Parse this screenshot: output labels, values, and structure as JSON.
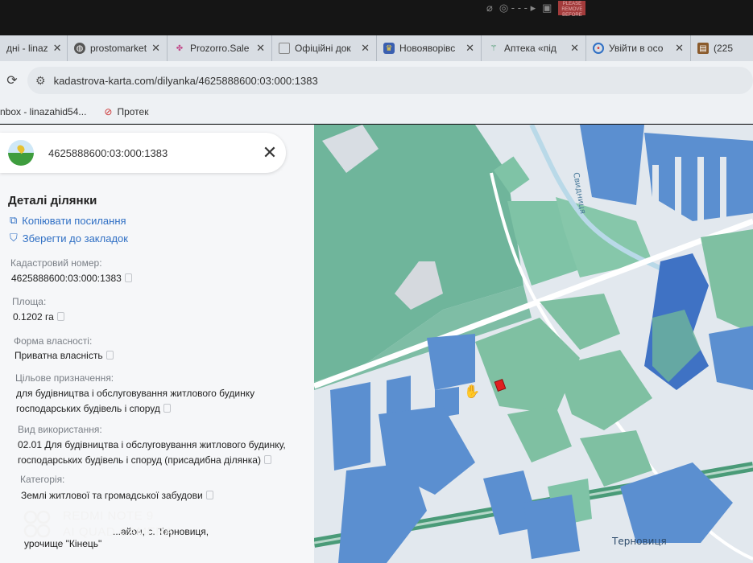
{
  "camera_bar": {
    "badge_text": "PLEASE REMOVE BEFORE"
  },
  "tabs": [
    {
      "label": "дні - linaz",
      "favicon": "mail-icon"
    },
    {
      "label": "prostomarket",
      "favicon": "globe-icon"
    },
    {
      "label": "Prozorro.Sale",
      "favicon": "prozorro-icon"
    },
    {
      "label": "Офіційні док",
      "favicon": "document-icon"
    },
    {
      "label": "Новояворівс",
      "favicon": "emblem-icon"
    },
    {
      "label": "Аптека «під",
      "favicon": "pharmacy-icon"
    },
    {
      "label": "Увійти в осо",
      "favicon": "target-icon"
    },
    {
      "label": "(225",
      "favicon": "shop-icon"
    }
  ],
  "address_bar": {
    "url": "kadastrova-karta.com/dilyanka/4625888600:03:000:1383"
  },
  "bookmarks": [
    {
      "label": "nbox - linazahid54..."
    },
    {
      "label": "Протек"
    }
  ],
  "panel": {
    "search_value": "4625888600:03:000:1383",
    "section_title": "Деталі ділянки",
    "copy_link": "Копіювати посилання",
    "save_bookmark": "Зберегти до закладок",
    "fields": {
      "cadastral_label": "Кадастровий номер:",
      "cadastral_value": "4625888600:03:000:1383",
      "area_label": "Площа:",
      "area_value": "0.1202 га",
      "ownership_label": "Форма власності:",
      "ownership_value": "Приватна власність",
      "purpose_label": "Цільове призначення:",
      "purpose_value_1": "для будівництва і обслуговування житлового будинку",
      "purpose_value_2": "господарських будівель і споруд",
      "usage_label": "Вид використання:",
      "usage_value_1": "02.01 Для будівництва і обслуговування житлового будинку,",
      "usage_value_2": "господарських будівель і споруд (присадибна ділянка)",
      "category_label": "Категорія:",
      "category_value": "Землі житлової та громадської забудови",
      "address_value_1": "...айон, с. Терновиця,",
      "address_value_2": "урочище \"Кінець\""
    }
  },
  "map": {
    "river_label": "Свидниця",
    "village_label": "Терновиця",
    "colors": {
      "forest": "#6fb59b",
      "residential": "#7fc0a2",
      "private_blue": "#5b8fd0",
      "selected": "#e02020",
      "road": "#ffffff"
    }
  },
  "watermark": {
    "line1": "REDMI NOTE 9",
    "line2": "AI QUAD CAMERA"
  }
}
